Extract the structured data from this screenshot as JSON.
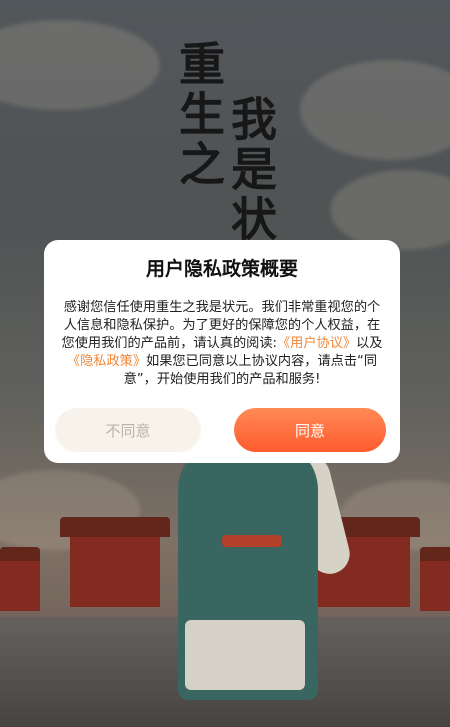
{
  "game_title": "重生之我是状元",
  "title_col1": "重生之",
  "title_col2": "我是状",
  "dialog": {
    "title": "用户隐私政策概要",
    "body_part1": "感谢您信任使用重生之我是状元。我们非常重视您的个人信息和隐私保护。为了更好的保障您的个人权益，在您使用我们的产品前，请认真的阅读:",
    "user_agreement_link": "《用户协议》",
    "body_conj": "以及",
    "privacy_policy_link": "《隐私政策》",
    "body_part2": "如果您已同意以上协议内容，请点击“同意”，开始使用我们的产品和服务!",
    "disagree_label": "不同意",
    "agree_label": "同意"
  },
  "colors": {
    "link": "#f0883a",
    "agree_button": "#ff6a3a",
    "disagree_button": "#f7f3ea"
  }
}
